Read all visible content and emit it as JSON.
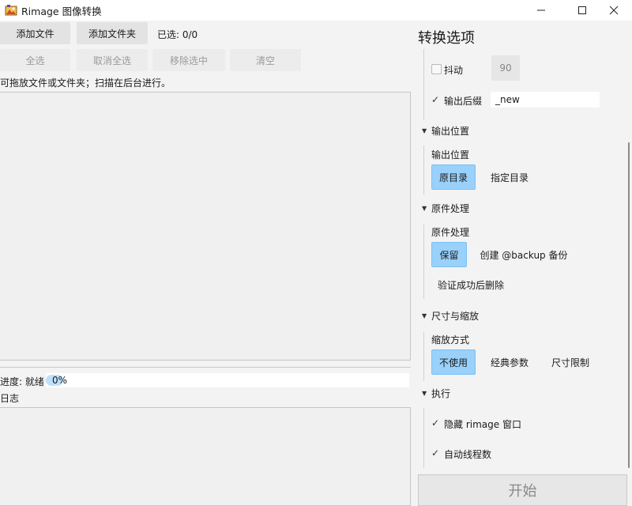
{
  "window": {
    "title": "Rimage 图像转换",
    "controls": {
      "minimize": "—",
      "maximize": "☐",
      "close": "✕"
    }
  },
  "toolbar": {
    "add_file": "添加文件",
    "add_folder": "添加文件夹",
    "selected_count": "已选: 0/0",
    "select_all": "全选",
    "deselect_all": "取消全选",
    "remove_selected": "移除选中",
    "clear": "清空"
  },
  "hint": "可拖放文件或文件夹；扫描在后台进行。",
  "progress": {
    "label": "进度: 就绪",
    "value_text": "0%",
    "value": 0
  },
  "log": {
    "label": "日志"
  },
  "options": {
    "title": "转换选项",
    "dither": {
      "label": "抖动",
      "checked": false,
      "value": "90"
    },
    "suffix": {
      "label": "输出后缀",
      "checked": true,
      "value": "_new"
    },
    "output_location": {
      "header": "输出位置",
      "label": "输出位置",
      "choices": [
        "原目录",
        "指定目录"
      ],
      "selected": "原目录"
    },
    "original_handling": {
      "header": "原件处理",
      "label": "原件处理",
      "choices": [
        "保留",
        "创建 @backup 备份",
        "验证成功后删除"
      ],
      "selected": "保留"
    },
    "resize": {
      "header": "尺寸与缩放",
      "label": "缩放方式",
      "choices": [
        "不使用",
        "经典参数",
        "尺寸限制"
      ],
      "selected": "不使用"
    },
    "execute": {
      "header": "执行",
      "hide_window": {
        "label": "隐藏 rimage 窗口",
        "checked": true
      },
      "auto_threads": {
        "label": "自动线程数",
        "checked": true
      }
    },
    "start": "开始"
  },
  "colors": {
    "accent": "#99d1fb",
    "progress_fill": "#bfe0fb"
  }
}
